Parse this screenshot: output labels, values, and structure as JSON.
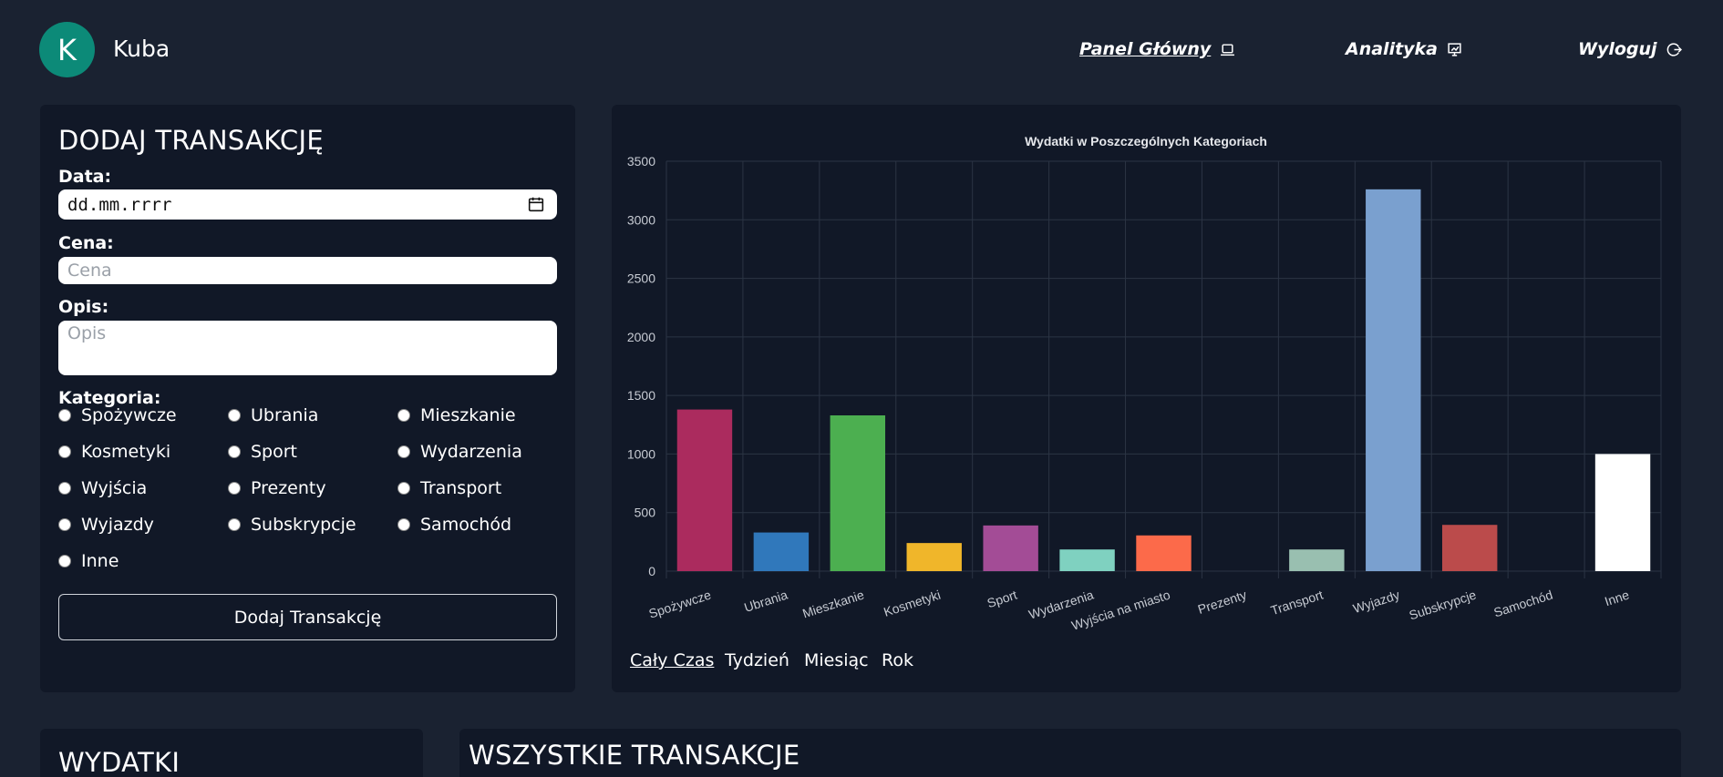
{
  "user": {
    "initial": "K",
    "name": "Kuba"
  },
  "nav": {
    "dashboard": "Panel Główny",
    "analytics": "Analityka",
    "logout": "Wyloguj"
  },
  "add_form": {
    "title": "DODAJ TRANSAKCJĘ",
    "date_label": "Data:",
    "date_value": "dd.mm.rrrr",
    "price_label": "Cena:",
    "price_placeholder": "Cena",
    "desc_label": "Opis:",
    "desc_placeholder": "Opis",
    "category_label": "Kategoria:",
    "categories": [
      "Spożywcze",
      "Ubrania",
      "Mieszkanie",
      "Kosmetyki",
      "Sport",
      "Wydarzenia",
      "Wyjścia",
      "Prezenty",
      "Transport",
      "Wyjazdy",
      "Subskrypcje",
      "Samochód",
      "Inne"
    ],
    "submit_label": "Dodaj Transakcję"
  },
  "periods": [
    "Cały Czas",
    "Tydzień",
    "Miesiąc",
    "Rok"
  ],
  "sections": {
    "expenses_title": "WYDATKI",
    "all_title": "WSZYSTKIE TRANSAKCJE"
  },
  "chart_data": {
    "type": "bar",
    "title": "Wydatki w Poszczególnych Kategoriach",
    "categories": [
      "Spożywcze",
      "Ubrania",
      "Mieszkanie",
      "Kosmetyki",
      "Sport",
      "Wydarzenia",
      "Wyjścia na miasto",
      "Prezenty",
      "Transport",
      "Wyjazdy",
      "Subskrypcje",
      "Samochód",
      "Inne"
    ],
    "values": [
      1380,
      330,
      1330,
      240,
      390,
      185,
      305,
      0,
      185,
      3260,
      395,
      0,
      1000
    ],
    "colors": [
      "#ab2b5e",
      "#3078bb",
      "#4caf50",
      "#f0b62a",
      "#a34c96",
      "#7fd1c0",
      "#fc6a4a",
      "#c0c0c0",
      "#99bfb0",
      "#7aa0cf",
      "#bb4b4b",
      "#888888",
      "#ffffff"
    ],
    "ylim": [
      0,
      3500
    ],
    "yticks": [
      0,
      500,
      1000,
      1500,
      2000,
      2500,
      3000,
      3500
    ],
    "grid": true
  }
}
